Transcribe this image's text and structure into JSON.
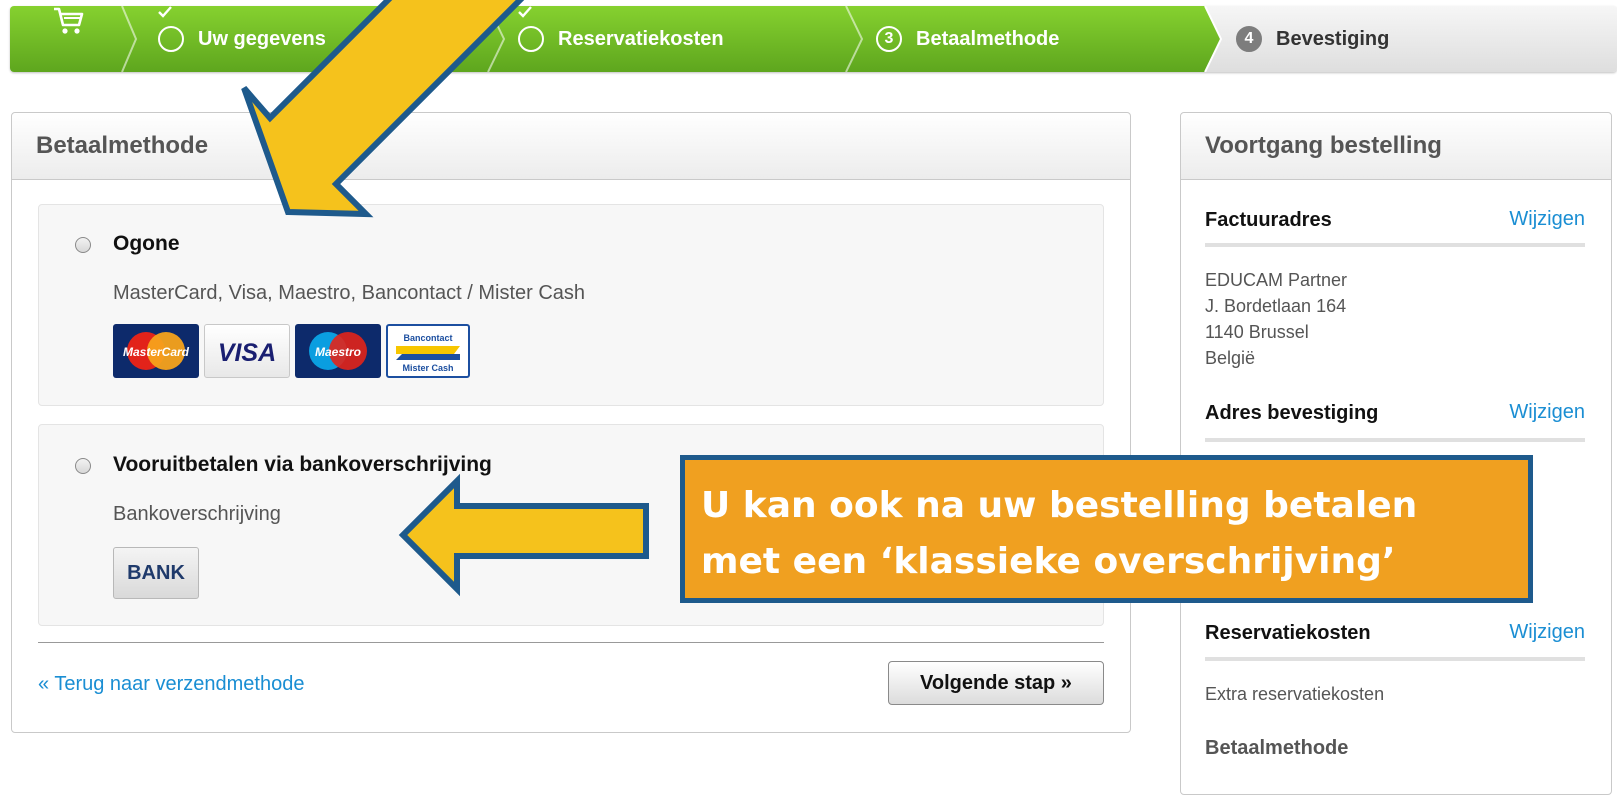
{
  "steps": [
    {
      "label": "Uw gegevens",
      "state": "done"
    },
    {
      "label": "Reservatiekosten",
      "state": "done"
    },
    {
      "label": "Betaalmethode",
      "state": "current",
      "number": "3"
    },
    {
      "label": "Bevestiging",
      "state": "todo",
      "number": "4"
    }
  ],
  "colors": {
    "green": "#6fbf26",
    "link": "#1a8ed3",
    "callout": "#f0a020",
    "arrow": "#f5c21c",
    "arrow_border": "#1e5a8c"
  },
  "payment": {
    "heading": "Betaalmethode",
    "options": [
      {
        "title": "Ogone",
        "description": "MasterCard, Visa, Maestro, Bancontact / Mister Cash",
        "logos": [
          "MasterCard",
          "VISA",
          "Maestro",
          "Bancontact",
          "Mister Cash"
        ]
      },
      {
        "title": "Vooruitbetalen via bankoverschrijving",
        "description": "Bankoverschrijving",
        "logos": [
          "BANK"
        ]
      }
    ],
    "back_link": "« Terug naar verzendmethode",
    "next_button": "Volgende stap »"
  },
  "progress": {
    "heading": "Voortgang bestelling",
    "invoice": {
      "title": "Factuuradres",
      "edit": "Wijzigen",
      "lines": [
        "EDUCAM Partner",
        "J. Bordetlaan 164",
        "1140 Brussel",
        "België"
      ]
    },
    "address_confirm": {
      "title": "Adres bevestiging",
      "edit": "Wijzigen"
    },
    "reservation": {
      "title": "Reservatiekosten",
      "edit": "Wijzigen",
      "value": "Extra reservatiekosten"
    },
    "payment_title": "Betaalmethode"
  },
  "annotation": {
    "line1": "U kan ook na uw bestelling betalen",
    "line2": "met een ‘klassieke overschrijving’"
  }
}
